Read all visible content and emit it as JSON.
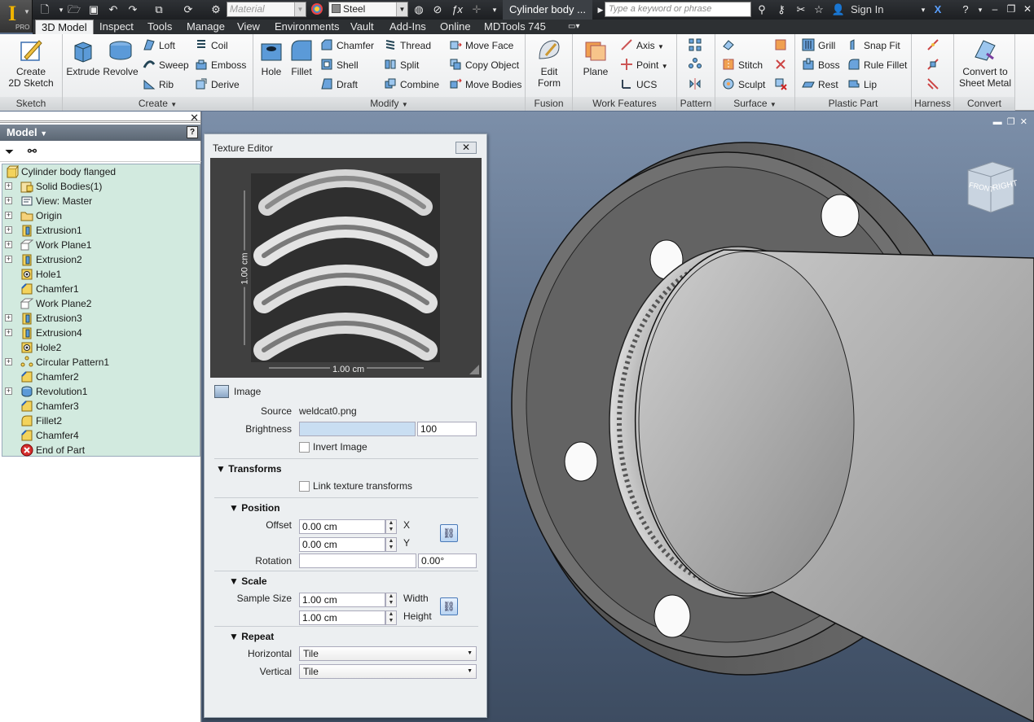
{
  "qat": {
    "material": "Material",
    "appearance": "Steel",
    "doc_title": "Cylinder body ...",
    "search_placeholder": "Type a keyword or phrase",
    "sign_in": "Sign In",
    "app_badge": "PRO"
  },
  "tabs": [
    "3D Model",
    "Inspect",
    "Tools",
    "Manage",
    "View",
    "Environments",
    "Vault",
    "Add-Ins",
    "Online",
    "MDTools 745"
  ],
  "ribbon": {
    "sketch": {
      "title": "Sketch",
      "create_sketch": "Create\n2D Sketch"
    },
    "create": {
      "title": "Create",
      "extrude": "Extrude",
      "revolve": "Revolve",
      "loft": "Loft",
      "sweep": "Sweep",
      "rib": "Rib",
      "coil": "Coil",
      "emboss": "Emboss",
      "derive": "Derive"
    },
    "modify": {
      "title": "Modify",
      "hole": "Hole",
      "fillet": "Fillet",
      "chamfer": "Chamfer",
      "shell": "Shell",
      "draft": "Draft",
      "thread": "Thread",
      "split": "Split",
      "combine": "Combine",
      "move_face": "Move Face",
      "copy_object": "Copy Object",
      "move_bodies": "Move Bodies"
    },
    "fusion": {
      "title": "Fusion",
      "edit_form": "Edit\nForm"
    },
    "work": {
      "title": "Work Features",
      "plane": "Plane",
      "axis": "Axis",
      "point": "Point",
      "ucs": "UCS"
    },
    "pattern": {
      "title": "Pattern"
    },
    "surface": {
      "title": "Surface",
      "stitch": "Stitch",
      "sculpt": "Sculpt"
    },
    "plastic": {
      "title": "Plastic Part",
      "grill": "Grill",
      "boss": "Boss",
      "rest": "Rest",
      "snap_fit": "Snap Fit",
      "rule_fillet": "Rule Fillet",
      "lip": "Lip"
    },
    "harness": {
      "title": "Harness"
    },
    "convert": {
      "title": "Convert",
      "convert_sheet": "Convert to\nSheet Metal"
    }
  },
  "browser": {
    "title": "Model",
    "items": [
      {
        "label": "Cylinder body flanged",
        "icon": "part-icon",
        "expand": false
      },
      {
        "label": "Solid Bodies(1)",
        "icon": "solid-bodies-icon",
        "expand": true
      },
      {
        "label": "View: Master",
        "icon": "view-icon",
        "expand": true
      },
      {
        "label": "Origin",
        "icon": "folder-icon",
        "expand": true
      },
      {
        "label": "Extrusion1",
        "icon": "extrusion-icon",
        "expand": true
      },
      {
        "label": "Work Plane1",
        "icon": "work-plane-icon",
        "expand": true
      },
      {
        "label": "Extrusion2",
        "icon": "extrusion-icon",
        "expand": true
      },
      {
        "label": "Hole1",
        "icon": "hole-icon",
        "expand": false
      },
      {
        "label": "Chamfer1",
        "icon": "chamfer-icon",
        "expand": false
      },
      {
        "label": "Work Plane2",
        "icon": "work-plane-icon",
        "expand": false
      },
      {
        "label": "Extrusion3",
        "icon": "extrusion-icon",
        "expand": true
      },
      {
        "label": "Extrusion4",
        "icon": "extrusion-icon",
        "expand": true
      },
      {
        "label": "Hole2",
        "icon": "hole-icon",
        "expand": false
      },
      {
        "label": "Circular Pattern1",
        "icon": "pattern-icon",
        "expand": true
      },
      {
        "label": "Chamfer2",
        "icon": "chamfer-icon",
        "expand": false
      },
      {
        "label": "Revolution1",
        "icon": "revolve-icon",
        "expand": true
      },
      {
        "label": "Chamfer3",
        "icon": "chamfer-icon",
        "expand": false
      },
      {
        "label": "Fillet2",
        "icon": "fillet-icon",
        "expand": false
      },
      {
        "label": "Chamfer4",
        "icon": "chamfer-icon",
        "expand": false
      },
      {
        "label": "End of Part",
        "icon": "end-of-part-icon",
        "expand": false
      }
    ]
  },
  "view_cube": {
    "front": "FRONT",
    "right": "RIGHT"
  },
  "texture_editor": {
    "title": "Texture Editor",
    "preview_h": "1.00 cm",
    "preview_v": "1.00 cm",
    "image_label": "Image",
    "source_label": "Source",
    "source_value": "weldcat0.png",
    "brightness_label": "Brightness",
    "brightness_value": "100",
    "brightness_fill": 1.0,
    "invert_label": "Invert Image",
    "transforms_label": "Transforms",
    "link_label": "Link texture transforms",
    "position_label": "Position",
    "offset_label": "Offset",
    "offset_x": "0.00 cm",
    "offset_y": "0.00 cm",
    "x_label": "X",
    "y_label": "Y",
    "rotation_label": "Rotation",
    "rotation_value": "0.00°",
    "scale_label": "Scale",
    "sample_size_label": "Sample Size",
    "width_value": "1.00 cm",
    "height_value": "1.00 cm",
    "width_label": "Width",
    "height_label": "Height",
    "repeat_label": "Repeat",
    "horizontal_label": "Horizontal",
    "vertical_label": "Vertical",
    "horizontal_value": "Tile",
    "vertical_value": "Tile"
  }
}
